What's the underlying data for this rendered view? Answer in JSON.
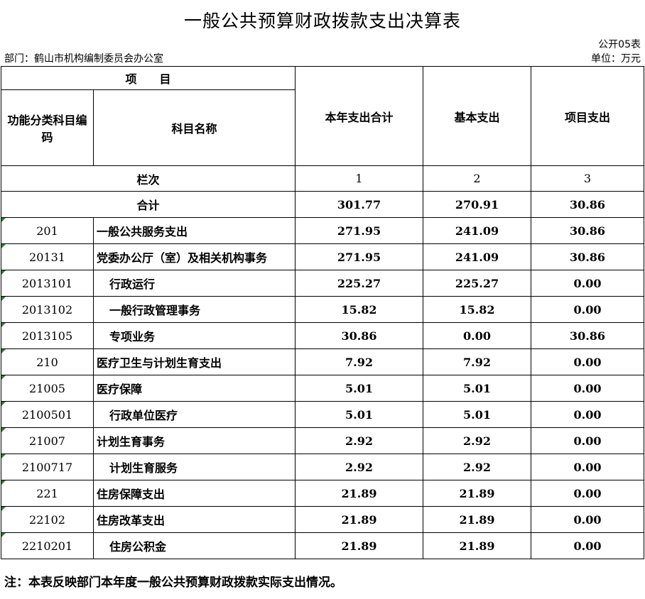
{
  "title": "一般公共预算财政拨款支出决算表",
  "form_no": "公开05表",
  "department": "部门：鹤山市机构编制委员会办公室",
  "unit": "单位：万元",
  "header": {
    "item": "项　　目",
    "code": "功能分类科目编码",
    "name": "科目名称",
    "col1": "本年支出合计",
    "col2": "基本支出",
    "col3": "项目支出",
    "lanci": "栏次",
    "n1": "1",
    "n2": "2",
    "n3": "3"
  },
  "total": {
    "label": "合计",
    "c1": "301.77",
    "c2": "270.91",
    "c3": "30.86"
  },
  "rows": [
    {
      "code": "201",
      "name": "一般公共服务支出",
      "c1": "271.95",
      "c2": "241.09",
      "c3": "30.86"
    },
    {
      "code": "20131",
      "name": "党委办公厅（室）及相关机构事务",
      "c1": "271.95",
      "c2": "241.09",
      "c3": "30.86"
    },
    {
      "code": "2013101",
      "name": "行政运行",
      "c1": "225.27",
      "c2": "225.27",
      "c3": "0.00"
    },
    {
      "code": "2013102",
      "name": "一般行政管理事务",
      "c1": "15.82",
      "c2": "15.82",
      "c3": "0.00"
    },
    {
      "code": "2013105",
      "name": "专项业务",
      "c1": "30.86",
      "c2": "0.00",
      "c3": "30.86"
    },
    {
      "code": "210",
      "name": "医疗卫生与计划生育支出",
      "c1": "7.92",
      "c2": "7.92",
      "c3": "0.00"
    },
    {
      "code": "21005",
      "name": "医疗保障",
      "c1": "5.01",
      "c2": "5.01",
      "c3": "0.00"
    },
    {
      "code": "2100501",
      "name": "行政单位医疗",
      "c1": "5.01",
      "c2": "5.01",
      "c3": "0.00"
    },
    {
      "code": "21007",
      "name": "计划生育事务",
      "c1": "2.92",
      "c2": "2.92",
      "c3": "0.00"
    },
    {
      "code": "2100717",
      "name": "计划生育服务",
      "c1": "2.92",
      "c2": "2.92",
      "c3": "0.00"
    },
    {
      "code": "221",
      "name": "住房保障支出",
      "c1": "21.89",
      "c2": "21.89",
      "c3": "0.00"
    },
    {
      "code": "22102",
      "name": "住房改革支出",
      "c1": "21.89",
      "c2": "21.89",
      "c3": "0.00"
    },
    {
      "code": "2210201",
      "name": "住房公积金",
      "c1": "21.89",
      "c2": "21.89",
      "c3": "0.00"
    }
  ],
  "note": "注：本表反映部门本年度一般公共预算财政拨款实际支出情况。",
  "marker_color": "#2e7d32"
}
